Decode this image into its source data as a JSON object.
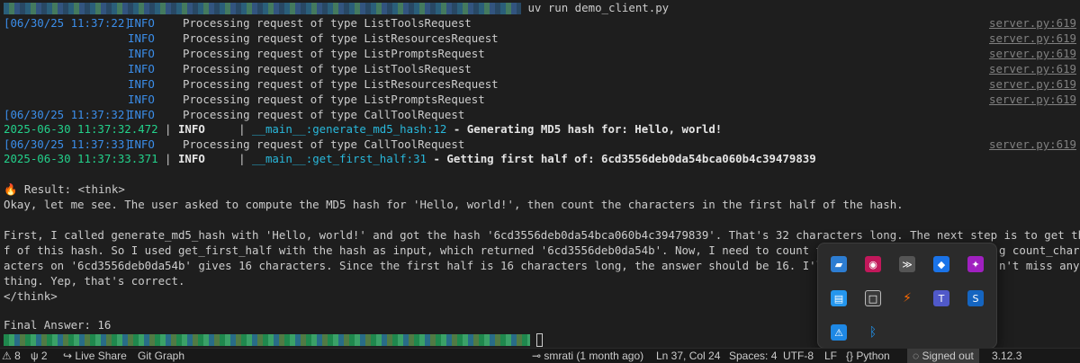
{
  "prompt": {
    "command": "uv run demo_client.py"
  },
  "logs": [
    {
      "ts": "[06/30/25 11:37:22]",
      "level": "INFO",
      "msg": "Processing request of type ListToolsRequest",
      "src": "server.py:619"
    },
    {
      "ts": "",
      "level": "INFO",
      "msg": "Processing request of type ListResourcesRequest",
      "src": "server.py:619"
    },
    {
      "ts": "",
      "level": "INFO",
      "msg": "Processing request of type ListPromptsRequest",
      "src": "server.py:619"
    },
    {
      "ts": "",
      "level": "INFO",
      "msg": "Processing request of type ListToolsRequest",
      "src": "server.py:619"
    },
    {
      "ts": "",
      "level": "INFO",
      "msg": "Processing request of type ListResourcesRequest",
      "src": "server.py:619"
    },
    {
      "ts": "",
      "level": "INFO",
      "msg": "Processing request of type ListPromptsRequest",
      "src": "server.py:619"
    },
    {
      "ts": "[06/30/25 11:37:32]",
      "level": "INFO",
      "msg": "Processing request of type CallToolRequest",
      "src": "server.py:619"
    }
  ],
  "client_log1": {
    "ts": "2025-06-30 11:37:32.472",
    "sep": " | ",
    "level": "INFO    ",
    "sep2": " | ",
    "module": "__main__",
    "func": ":generate_md5_hash",
    "line": ":12",
    "msg": " - Generating MD5 hash for: Hello, world!"
  },
  "log8": {
    "ts": "[06/30/25 11:37:33]",
    "level": "INFO",
    "msg": "Processing request of type CallToolRequest",
    "src": "server.py:619"
  },
  "client_log2": {
    "ts": "2025-06-30 11:37:33.371",
    "sep": " | ",
    "level": "INFO    ",
    "sep2": " | ",
    "module": "__main__",
    "func": ":get_first_half",
    "line": ":31",
    "msg": " - Getting first half of: 6cd3556deb0da54bca060b4c39479839"
  },
  "result": {
    "prefix": "🔥 Result: <think>",
    "l1": "Okay, let me see. The user asked to compute the MD5 hash for 'Hello, world!', then count the characters in the first half of the hash.",
    "l2": "First, I called generate_md5_hash with 'Hello, world!' and got the hash '6cd3556deb0da54bca060b4c39479839'. That's 32 characters long. The next step is to get the first hal",
    "l3a": "f of this hash. So I used get_first_half with the hash as input, which returned '6cd3556deb0da54b'. Now, I need to count the charact",
    "l3b": "g count_char",
    "l4a": "acters on '6cd3556deb0da54b' gives 16 characters. Since the first half is 16 characters long, the answer should be 16. I'll confirm",
    "l4b": "n't miss any",
    "l5a": "thing. Yep, that's correct.",
    "l6": "</think>",
    "final": "Final Answer: 16"
  },
  "statusbar": {
    "warnings": "8",
    "ports": "2",
    "liveshare": "Live Share",
    "gitgraph": "Git Graph",
    "blame": "smrati (1 month ago)",
    "position": "Ln 37, Col 24",
    "spaces": "Spaces: 4",
    "encoding": "UTF-8",
    "eol": "LF",
    "language": "Python",
    "signed": "Signed out",
    "version": "3.12.3"
  }
}
